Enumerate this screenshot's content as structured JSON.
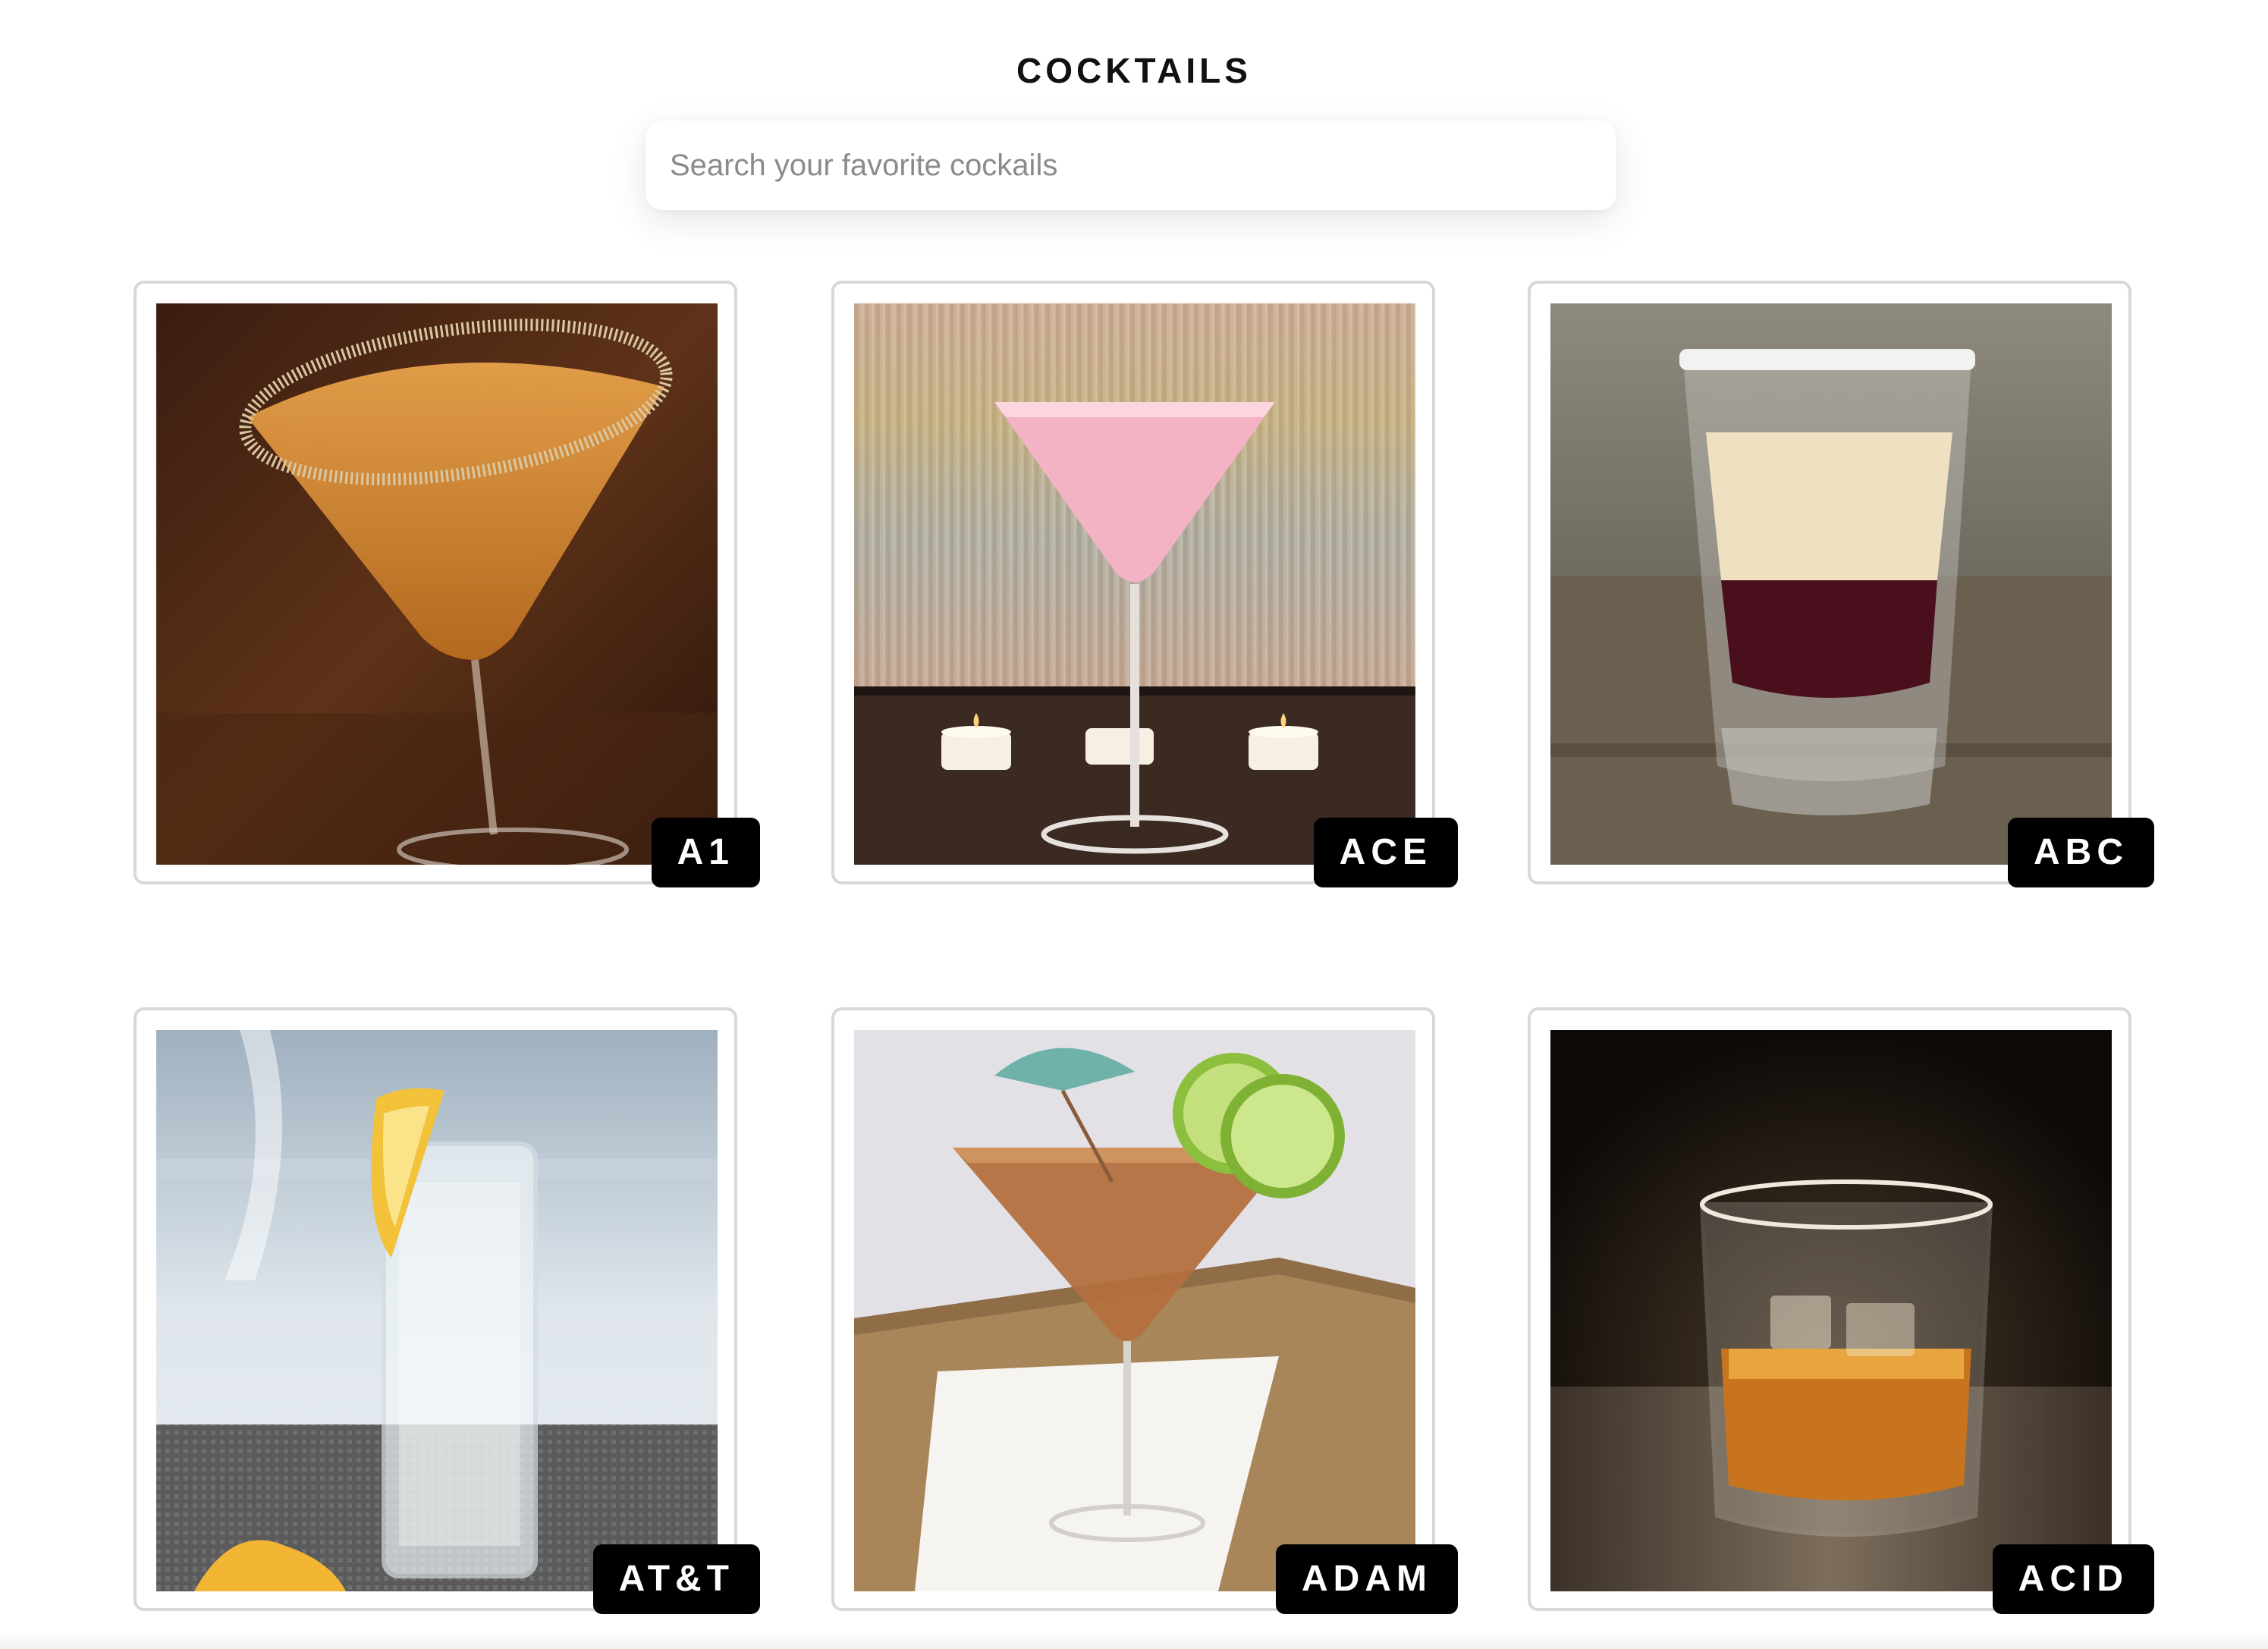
{
  "header": {
    "title": "COCKTAILS"
  },
  "search": {
    "placeholder": "Search your favorite cockails",
    "value": ""
  },
  "drinks": [
    {
      "name": "A1",
      "image_icon": "orange-martini-glass-icon"
    },
    {
      "name": "ACE",
      "image_icon": "pink-martini-glass-icon"
    },
    {
      "name": "ABC",
      "image_icon": "layered-shot-glass-icon"
    },
    {
      "name": "AT&T",
      "image_icon": "highball-glass-lemon-icon"
    },
    {
      "name": "ADAM",
      "image_icon": "martini-umbrella-lime-icon"
    },
    {
      "name": "ACID",
      "image_icon": "whiskey-rocks-glass-icon"
    }
  ],
  "colors": {
    "badge_bg": "#000000",
    "badge_text": "#ffffff",
    "card_border": "#d8d8d8"
  }
}
